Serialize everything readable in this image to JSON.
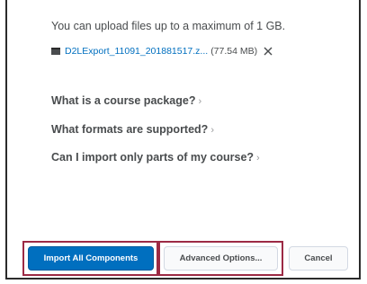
{
  "upload": {
    "note": "You can upload files up to a maximum of 1 GB.",
    "file_name": "D2LExport_11091_201881517.z...",
    "file_size": "(77.54 MB)"
  },
  "faq": [
    {
      "label": "What is a course package?",
      "chevron": "›"
    },
    {
      "label": "What formats are supported?",
      "chevron": "›"
    },
    {
      "label": "Can I import only parts of my course?",
      "chevron": "›"
    }
  ],
  "buttons": {
    "import_all": "Import All Components",
    "advanced": "Advanced Options...",
    "cancel": "Cancel"
  },
  "colors": {
    "primary": "#006fbf",
    "highlight": "#9c2a44",
    "text": "#494c4e"
  },
  "icons": {
    "file": "file-icon",
    "remove": "close-icon"
  }
}
